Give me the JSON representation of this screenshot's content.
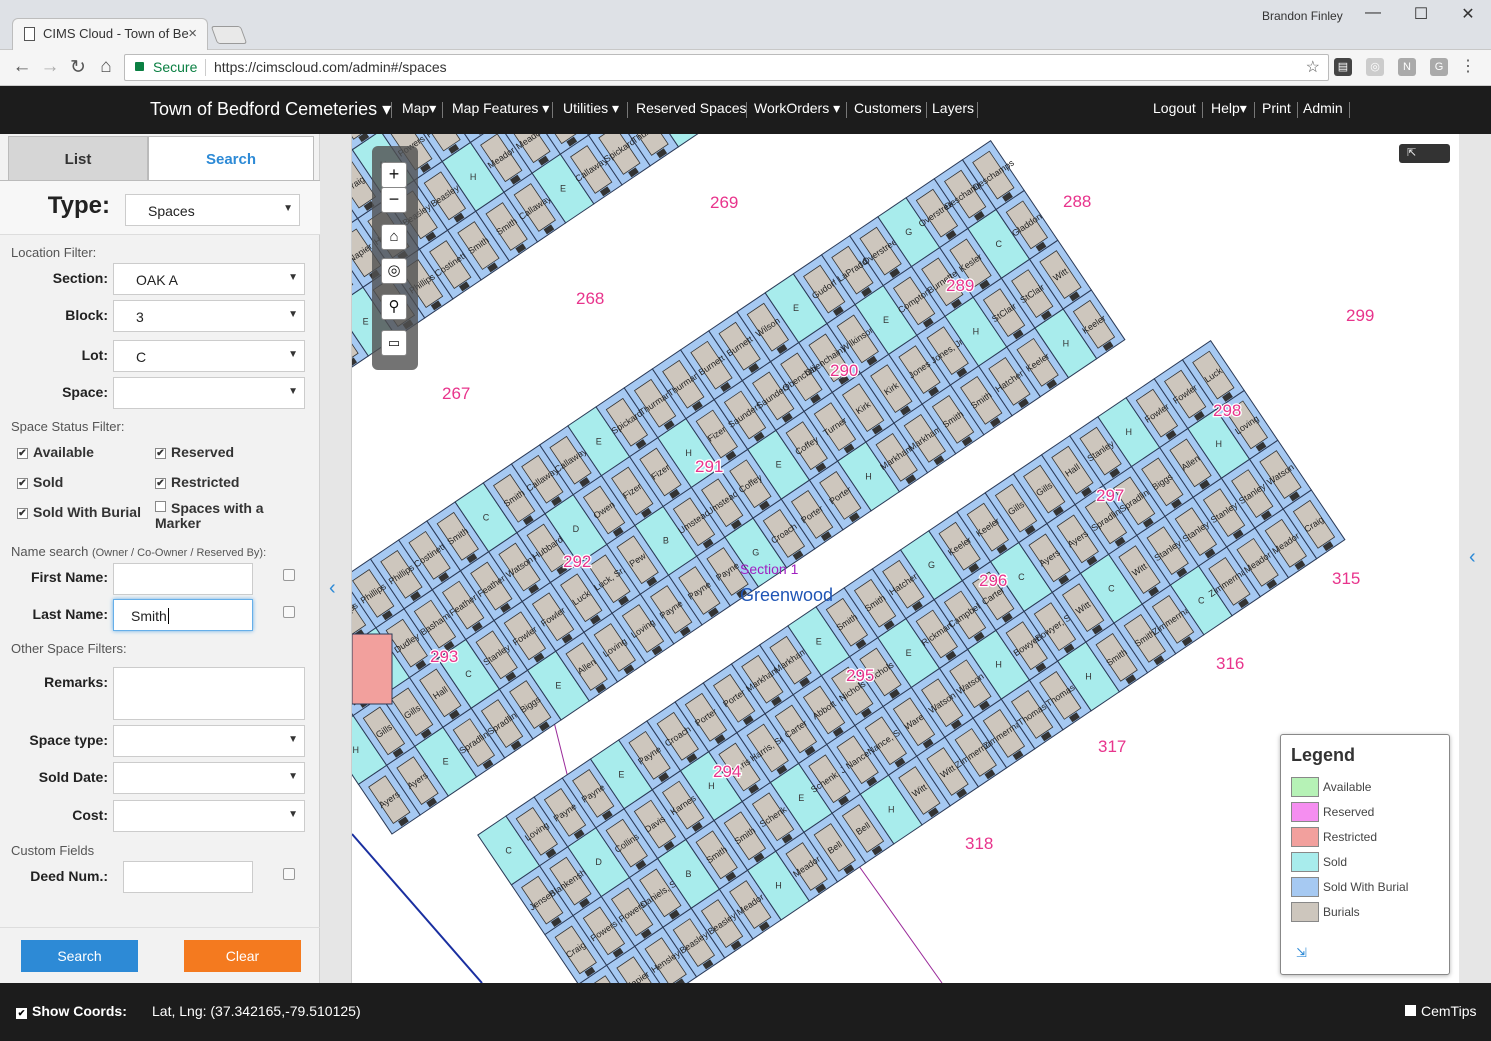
{
  "browser": {
    "tab_title": "CIMS Cloud - Town of Be",
    "user_name": "Brandon Finley",
    "secure_label": "Secure",
    "url": "https://cimscloud.com/admin#/spaces"
  },
  "nav": {
    "title": "Town of Bedford Cemeteries",
    "items": [
      "Map",
      "Map Features",
      "Utilities",
      "Reserved Spaces",
      "WorkOrders",
      "Customers",
      "Layers"
    ],
    "right_items": [
      "Logout",
      "Help",
      "Print",
      "Admin"
    ]
  },
  "sidebar": {
    "tabs": {
      "list": "List",
      "search": "Search"
    },
    "type_label": "Type:",
    "type_value": "Spaces",
    "location_filter": "Location Filter:",
    "section_label": "Section:",
    "section_value": "OAK A",
    "block_label": "Block:",
    "block_value": "3",
    "lot_label": "Lot:",
    "lot_value": "C",
    "space_label": "Space:",
    "space_value": "",
    "status_filter": "Space Status Filter:",
    "statuses": {
      "available": "Available",
      "reserved": "Reserved",
      "sold": "Sold",
      "restricted": "Restricted",
      "sold_burial": "Sold With Burial",
      "marker_1": "Spaces with a",
      "marker_2": "Marker"
    },
    "name_search": "Name search",
    "name_search_hint": "(Owner / Co-Owner / Reserved By):",
    "first_name_label": "First Name:",
    "first_name_value": "",
    "last_name_label": "Last Name:",
    "last_name_value": "Smith",
    "other_filters": "Other Space Filters:",
    "remarks_label": "Remarks:",
    "space_type_label": "Space type:",
    "sold_date_label": "Sold Date:",
    "cost_label": "Cost:",
    "custom_fields": "Custom Fields",
    "deed_label": "Deed Num.:",
    "search_btn": "Search",
    "clear_btn": "Clear"
  },
  "map": {
    "section_label": "Section 1",
    "area_label": "Greenwood",
    "lot_numbers": [
      "267",
      "268",
      "269",
      "288",
      "289",
      "290",
      "291",
      "292",
      "293",
      "294",
      "295",
      "296",
      "297",
      "298",
      "299",
      "315",
      "316",
      "317",
      "318"
    ],
    "names": [
      "Witt",
      "Phillips",
      "Phillips",
      "Phillips",
      "Costinett",
      "Smith",
      "Smith",
      "Callaway",
      "Callaway",
      "Spickard",
      "Thurman",
      "Thurman",
      "Burnett",
      "Burnett",
      "Wilson",
      "Gudorf",
      "LaPradd",
      "Overstreet",
      "Overstreet",
      "Deschamps",
      "Deschamps",
      "Napier",
      "Napier",
      "Hensley",
      "Beasley",
      "Beasley",
      "Meador",
      "Meador",
      "Bell",
      "Bell",
      "Witt",
      "Witt",
      "Zimmerman",
      "Zimmerman",
      "Thomas",
      "Thomas",
      "Smith",
      "Smith",
      "Zimmerman",
      "Zimmerman",
      "Meador",
      "Meador",
      "Craig",
      "Craig",
      "Powers",
      "Powers",
      "Daniels, Sr.",
      "Smith",
      "Smith",
      "Schenk",
      "Schenk, Jr",
      "Nance",
      "Nance, Sr.",
      "Ware",
      "Watson",
      "Watson",
      "Bowyer",
      "Bowyer, Sr.",
      "Witt",
      "Witt",
      "Stanley",
      "Stanley",
      "Stanley",
      "Stanley",
      "Watson",
      "Jensen",
      "Blankenship",
      "Collins",
      "Davis",
      "Karnes",
      "Harris",
      "Harris, Sr.",
      "Carter",
      "Abbott",
      "Nichols",
      "Nichols",
      "Rickman",
      "Campbell",
      "Carter",
      "Ayers",
      "Ayers",
      "Spradlin",
      "Spradlin",
      "Biggs",
      "Allen",
      "Loving",
      "Loving",
      "Payne",
      "Payne",
      "Payne",
      "Croach",
      "Porter",
      "Porter",
      "Markham",
      "Markham",
      "Smith",
      "Smith",
      "Hatcher",
      "Keeler",
      "Keeler",
      "Gills",
      "Gills",
      "Hall",
      "Stanley",
      "Fowler",
      "Fowler",
      "Luck",
      "Luck, Sr.",
      "Pew",
      "Umstead",
      "Umstead",
      "Coffey",
      "Coffey",
      "Turner",
      "Kirk",
      "Kirk",
      "Jones",
      "Jones, Jr.",
      "StClair",
      "StClair",
      "Witt",
      "Rider",
      "Rider",
      "Dudley",
      "Basham",
      "Feather",
      "Feather",
      "Watson",
      "Hubbard",
      "Owen",
      "Fizer",
      "Fizer",
      "Fizer",
      "Saunders",
      "Saunders",
      "Obenchain",
      "Obenchain, Sr",
      "Wilkinson",
      "Compton",
      "Burnette",
      "Kesler",
      "Gladdon"
    ],
    "letters": [
      "E",
      "E",
      "G",
      "H",
      "H",
      "H",
      "C",
      "B",
      "E",
      "H",
      "C",
      "D",
      "H",
      "E",
      "C",
      "H",
      "C"
    ]
  },
  "legend": {
    "title": "Legend",
    "items": [
      {
        "label": "Available",
        "color": "#b6f2b6"
      },
      {
        "label": "Reserved",
        "color": "#f58ef0"
      },
      {
        "label": "Restricted",
        "color": "#f2a09d"
      },
      {
        "label": "Sold",
        "color": "#a8ecec"
      },
      {
        "label": "Sold With Burial",
        "color": "#a6c9f2"
      },
      {
        "label": "Burials",
        "color": "#cdc6bd"
      }
    ]
  },
  "footer": {
    "show_coords": "Show Coords:",
    "coords": "Lat, Lng: (37.342165,-79.510125)",
    "cemtips": "CemTips"
  },
  "colors": {
    "accent_blue": "#2d8ad6",
    "clear_orange": "#f47a1f",
    "lot_number_pink": "#e8348c"
  },
  "icons": [
    "doc-icon",
    "close-icon",
    "back-icon",
    "forward-icon",
    "reload-icon",
    "home-icon",
    "lock-icon",
    "star-icon",
    "zoom-in-icon",
    "zoom-out-icon",
    "home-extent-icon",
    "compass-icon",
    "magnify-icon",
    "ruler-icon",
    "collapse-left-icon",
    "expand-right-icon"
  ]
}
